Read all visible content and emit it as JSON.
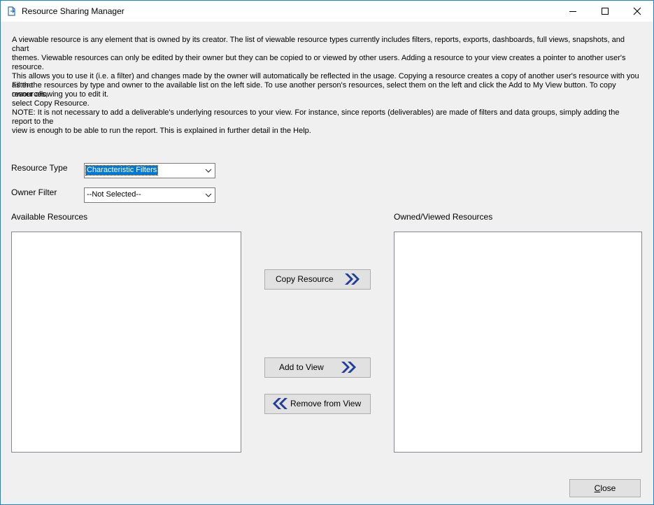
{
  "window": {
    "title": "Resource Sharing Manager"
  },
  "description": {
    "paragraph1": "A viewable resource is any element that is owned by its creator. The list of viewable resource types currently includes filters, reports, exports, dashboards, full views, snapshots, and chart\nthemes. Viewable resources can only be edited by their owner but they can be copied to or viewed by other users. Adding a resource to your view creates a pointer to another user's resource.\nThis allows you to use it (i.e. a filter) and changes made by the owner will automatically be reflected in the usage. Copying a resource creates a copy of another user's resource with you as the\nowner allowing you to edit it.",
    "paragraph2": "Filter the resources by type and owner to the available list on the left side. To use another person's resources, select them on the left and click the Add to My View button. To copy resources,\nselect Copy Resource.",
    "paragraph3": "NOTE: It is not necessary to add a deliverable's underlying resources to your view. For instance, since reports (deliverables) are made of filters and data groups, simply adding the report to the\nview is enough to be able to run the report. This is explained in further detail in the Help."
  },
  "filters": {
    "resource_type_label": "Resource Type",
    "resource_type_value": "Characteristic Filters",
    "owner_filter_label": "Owner Filter",
    "owner_filter_value": "--Not Selected--"
  },
  "lists": {
    "available_label": "Available Resources",
    "available_items": [],
    "owned_label": "Owned/Viewed Resources",
    "owned_items": []
  },
  "buttons": {
    "copy_label": "Copy Resource",
    "add_label": "Add to View",
    "remove_label": "Remove from View",
    "close_mnemonic": "C",
    "close_rest": "lose"
  },
  "colors": {
    "accent": "#1883d7",
    "arrow_icon": "#1f3d99",
    "selection": "#0078d7",
    "window_bg": "#f0f0f0"
  },
  "icons": {
    "app": "document-arrow-icon",
    "minimize": "minimize-icon",
    "maximize": "maximize-icon",
    "close": "close-icon",
    "dropdown": "chevron-down-icon",
    "forward": "double-chevron-right-icon",
    "back": "double-chevron-left-icon"
  }
}
